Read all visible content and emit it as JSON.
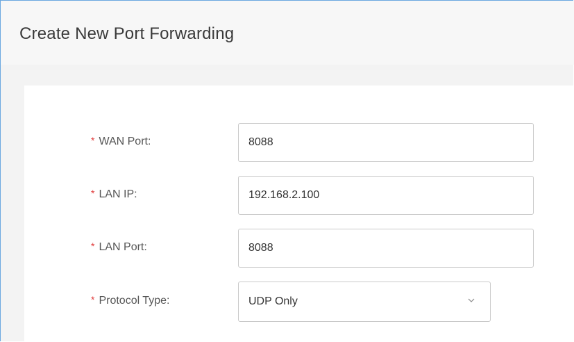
{
  "dialog": {
    "title": "Create New Port Forwarding"
  },
  "form": {
    "wan_port": {
      "label": "WAN Port:",
      "value": "8088"
    },
    "lan_ip": {
      "label": "LAN IP:",
      "value": "192.168.2.100"
    },
    "lan_port": {
      "label": "LAN Port:",
      "value": "8088"
    },
    "protocol_type": {
      "label": "Protocol Type:",
      "value": "UDP Only"
    },
    "required_marker": "*"
  },
  "colors": {
    "accent_border": "#6aa7e0",
    "required": "#e03a3a"
  }
}
